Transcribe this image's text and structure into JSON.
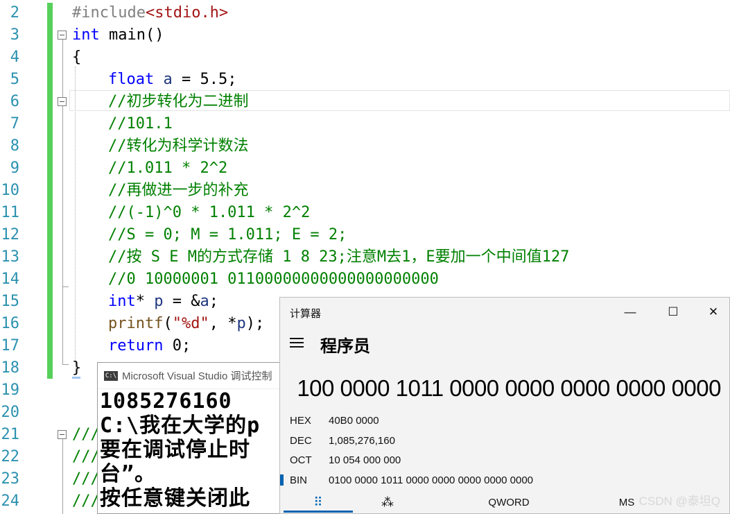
{
  "editor": {
    "line_numbers": [
      "2",
      "3",
      "4",
      "5",
      "6",
      "7",
      "8",
      "9",
      "10",
      "11",
      "12",
      "13",
      "14",
      "15",
      "16",
      "17",
      "18",
      "19",
      "20",
      "21",
      "22",
      "23",
      "24"
    ],
    "lines": {
      "l2_pp": "#include",
      "l2_str": "<stdio.h>",
      "l3_kw": "int",
      "l3_rest": " main()",
      "l4": "{",
      "l5_kw": "float",
      "l5_var": " a",
      "l5_rest": " = 5.5;",
      "l6": "//初步转化为二进制",
      "l7": "//101.1",
      "l8": "//转化为科学计数法",
      "l9": "//1.011 * 2^2",
      "l10": "//再做进一步的补充",
      "l11": "//(-1)^0 * 1.011 * 2^2",
      "l12": "//S = 0; M = 1.011; E = 2;",
      "l13": "//按 S E M的方式存储 1 8 23;注意M去1，E要加一个中间值127",
      "l14": "//0 10000001 01100000000000000000000",
      "l15_kw": "int",
      "l15_a": "* ",
      "l15_var": "p",
      "l15_b": " = &",
      "l15_var2": "a",
      "l15_c": ";",
      "l16_fn": "printf",
      "l16_a": "(",
      "l16_str": "\"%d\"",
      "l16_b": ", *",
      "l16_var": "p",
      "l16_c": ");",
      "l17_kw": "return",
      "l17_rest": " 0;",
      "l18": "}",
      "l21": "///",
      "l22": "///",
      "l23": "///",
      "l24": "///"
    }
  },
  "console": {
    "title": "Microsoft Visual Studio 调试控制",
    "icon_label": "C:\\",
    "output_lines": [
      "1085276160",
      "C:\\我在大学的р",
      "要在调试停止时",
      "台”。",
      "按任意键关闭此"
    ]
  },
  "calculator": {
    "title": "计算器",
    "mode": "程序员",
    "display": "100 0000 1011 0000 0000 0000 0000 0000",
    "radix": [
      {
        "name": "HEX",
        "value": "40B0 0000"
      },
      {
        "name": "DEC",
        "value": "1,085,276,160"
      },
      {
        "name": "OCT",
        "value": "10 054 000 000"
      },
      {
        "name": "BIN",
        "value": "0100 0000 1011 0000 0000 0000 0000 0000"
      }
    ],
    "tabs": {
      "keypad_icon": "⠿",
      "bits_icon": "⁂",
      "word_size": "QWORD",
      "memory": "MS"
    },
    "window_buttons": {
      "minimize": "—",
      "maximize": "☐",
      "close": "✕"
    }
  },
  "watermark": "CSDN @泰坦Q"
}
